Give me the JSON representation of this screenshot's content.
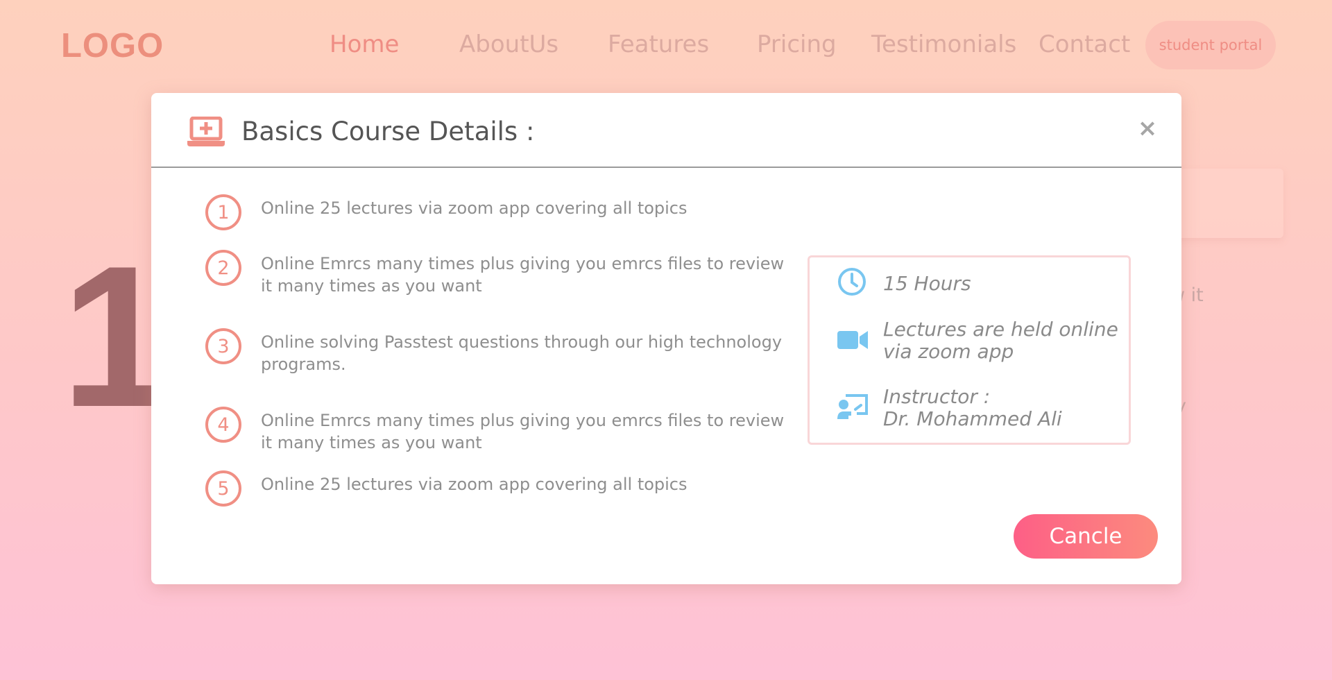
{
  "header": {
    "logo": "LOGO",
    "nav": [
      {
        "label": "Home",
        "active": true
      },
      {
        "label": "AboutUs",
        "active": false
      },
      {
        "label": "Features",
        "active": false
      },
      {
        "label": "Pricing",
        "active": false
      },
      {
        "label": "Testimonials",
        "active": false
      },
      {
        "label": "Contact",
        "active": false
      }
    ],
    "portal_button": "student portal"
  },
  "background": {
    "big_number": "1",
    "partial_text_1": "w it",
    "partial_text_2": "y"
  },
  "modal": {
    "title": "Basics Course Details :",
    "close_glyph": "×",
    "items": [
      {
        "number": "1",
        "text": "Online 25 lectures via zoom app covering all topics"
      },
      {
        "number": "2",
        "text": "Online Emrcs many times plus giving you emrcs files to review it many times as you want"
      },
      {
        "number": "3",
        "text": "Online solving Passtest questions through our high technology programs."
      },
      {
        "number": "4",
        "text": "Online Emrcs many times plus giving you emrcs files to review it many times as you want"
      },
      {
        "number": "5",
        "text": "Online 25 lectures via zoom app covering all topics"
      }
    ],
    "info": {
      "duration": "15 Hours",
      "delivery_line1": "Lectures are held online",
      "delivery_line2": "via zoom app",
      "instructor_label": "Instructor :",
      "instructor_name": "Dr. Mohammed Ali"
    },
    "cancel_button": "Cancle"
  },
  "colors": {
    "accent": "#f08f84",
    "info_icon": "#79c6f0",
    "button_gradient_start": "#fd5f86",
    "button_gradient_end": "#fc8b7e"
  },
  "icons": {
    "header": "laptop-medical-icon",
    "duration": "clock-icon",
    "delivery": "video-camera-icon",
    "instructor": "chalkboard-teacher-icon",
    "close": "close-icon"
  }
}
